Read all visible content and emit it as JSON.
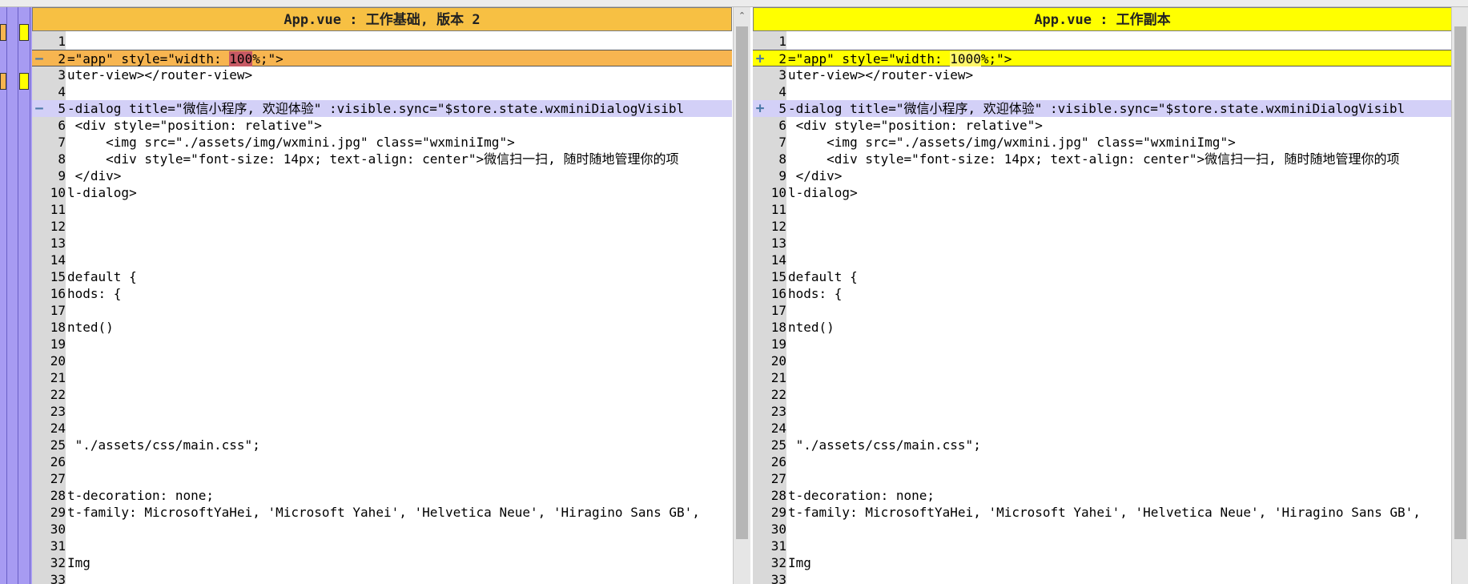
{
  "colors": {
    "left_header": "#f7c043",
    "right_header": "#ffff00",
    "changed_line": "#d3d0f7",
    "left_changed_strong": "#f7b550",
    "right_changed_strong": "#ffff00",
    "location_bar": "#a79bf2",
    "gutter": "#d9d9d9",
    "marker": "#4c7aa8"
  },
  "left_pane": {
    "title": "App.vue : 工作基础, 版本 2",
    "marker_glyph": "−",
    "lines": [
      {
        "num": "1",
        "pre": "",
        "hl": "",
        "post": "",
        "status": ""
      },
      {
        "num": "2",
        "pre": "=\"app\" style=\"width: ",
        "hl": "100",
        "post": "%;\">",
        "status": "strong"
      },
      {
        "num": "3",
        "pre": "uter-view></router-view>",
        "hl": "",
        "post": "",
        "status": ""
      },
      {
        "num": "4",
        "pre": "",
        "hl": "",
        "post": "",
        "status": ""
      },
      {
        "num": "5",
        "pre": "-dialog title=\"微信小程序, 欢迎体验\" :visible.sync=\"$store.state.wxminiDialogVisibl",
        "hl": "",
        "post": "",
        "status": "changed"
      },
      {
        "num": "6",
        "pre": " <div style=\"position: relative\">",
        "hl": "",
        "post": "",
        "status": ""
      },
      {
        "num": "7",
        "pre": "     <img src=\"./assets/img/wxmini.jpg\" class=\"wxminiImg\">",
        "hl": "",
        "post": "",
        "status": ""
      },
      {
        "num": "8",
        "pre": "     <div style=\"font-size: 14px; text-align: center\">微信扫一扫, 随时随地管理你的项",
        "hl": "",
        "post": "",
        "status": ""
      },
      {
        "num": "9",
        "pre": " </div>",
        "hl": "",
        "post": "",
        "status": ""
      },
      {
        "num": "10",
        "pre": "l-dialog>",
        "hl": "",
        "post": "",
        "status": ""
      },
      {
        "num": "11",
        "pre": "",
        "hl": "",
        "post": "",
        "status": ""
      },
      {
        "num": "12",
        "pre": "",
        "hl": "",
        "post": "",
        "status": ""
      },
      {
        "num": "13",
        "pre": "",
        "hl": "",
        "post": "",
        "status": ""
      },
      {
        "num": "14",
        "pre": "",
        "hl": "",
        "post": "",
        "status": ""
      },
      {
        "num": "15",
        "pre": "default {",
        "hl": "",
        "post": "",
        "status": ""
      },
      {
        "num": "16",
        "pre": "hods: {",
        "hl": "",
        "post": "",
        "status": ""
      },
      {
        "num": "17",
        "pre": "",
        "hl": "",
        "post": "",
        "status": ""
      },
      {
        "num": "18",
        "pre": "nted()",
        "hl": "",
        "post": "",
        "status": ""
      },
      {
        "num": "19",
        "pre": "",
        "hl": "",
        "post": "",
        "status": ""
      },
      {
        "num": "20",
        "pre": "",
        "hl": "",
        "post": "",
        "status": ""
      },
      {
        "num": "21",
        "pre": "",
        "hl": "",
        "post": "",
        "status": ""
      },
      {
        "num": "22",
        "pre": "",
        "hl": "",
        "post": "",
        "status": ""
      },
      {
        "num": "23",
        "pre": "",
        "hl": "",
        "post": "",
        "status": ""
      },
      {
        "num": "24",
        "pre": "",
        "hl": "",
        "post": "",
        "status": ""
      },
      {
        "num": "25",
        "pre": " \"./assets/css/main.css\";",
        "hl": "",
        "post": "",
        "status": ""
      },
      {
        "num": "26",
        "pre": "",
        "hl": "",
        "post": "",
        "status": ""
      },
      {
        "num": "27",
        "pre": "",
        "hl": "",
        "post": "",
        "status": ""
      },
      {
        "num": "28",
        "pre": "t-decoration: none;",
        "hl": "",
        "post": "",
        "status": ""
      },
      {
        "num": "29",
        "pre": "t-family: MicrosoftYaHei, 'Microsoft Yahei', 'Helvetica Neue', 'Hiragino Sans GB',",
        "hl": "",
        "post": "",
        "status": ""
      },
      {
        "num": "30",
        "pre": "",
        "hl": "",
        "post": "",
        "status": ""
      },
      {
        "num": "31",
        "pre": "",
        "hl": "",
        "post": "",
        "status": ""
      },
      {
        "num": "32",
        "pre": "Img",
        "hl": "",
        "post": "",
        "status": ""
      },
      {
        "num": "33",
        "pre": "",
        "hl": "",
        "post": "",
        "status": ""
      }
    ]
  },
  "right_pane": {
    "title": "App.vue : 工作副本",
    "marker_glyph": "+",
    "lines": [
      {
        "num": "1",
        "pre": "",
        "hl": "",
        "post": "",
        "status": ""
      },
      {
        "num": "2",
        "pre": "=\"app\" style=\"width: ",
        "hl": "1000",
        "post": "%;\">",
        "status": "strong"
      },
      {
        "num": "3",
        "pre": "uter-view></router-view>",
        "hl": "",
        "post": "",
        "status": ""
      },
      {
        "num": "4",
        "pre": "",
        "hl": "",
        "post": "",
        "status": ""
      },
      {
        "num": "5",
        "pre": "-dialog title=\"微信小程序, 欢迎体验\" :visible.sync=\"$store.state.wxminiDialogVisibl",
        "hl": "",
        "post": "",
        "status": "changed"
      },
      {
        "num": "6",
        "pre": " <div style=\"position: relative\">",
        "hl": "",
        "post": "",
        "status": ""
      },
      {
        "num": "7",
        "pre": "     <img src=\"./assets/img/wxmini.jpg\" class=\"wxminiImg\">",
        "hl": "",
        "post": "",
        "status": ""
      },
      {
        "num": "8",
        "pre": "     <div style=\"font-size: 14px; text-align: center\">微信扫一扫, 随时随地管理你的项",
        "hl": "",
        "post": "",
        "status": ""
      },
      {
        "num": "9",
        "pre": " </div>",
        "hl": "",
        "post": "",
        "status": ""
      },
      {
        "num": "10",
        "pre": "l-dialog>",
        "hl": "",
        "post": "",
        "status": ""
      },
      {
        "num": "11",
        "pre": "",
        "hl": "",
        "post": "",
        "status": ""
      },
      {
        "num": "12",
        "pre": "",
        "hl": "",
        "post": "",
        "status": ""
      },
      {
        "num": "13",
        "pre": "",
        "hl": "",
        "post": "",
        "status": ""
      },
      {
        "num": "14",
        "pre": "",
        "hl": "",
        "post": "",
        "status": ""
      },
      {
        "num": "15",
        "pre": "default {",
        "hl": "",
        "post": "",
        "status": ""
      },
      {
        "num": "16",
        "pre": "hods: {",
        "hl": "",
        "post": "",
        "status": ""
      },
      {
        "num": "17",
        "pre": "",
        "hl": "",
        "post": "",
        "status": ""
      },
      {
        "num": "18",
        "pre": "nted()",
        "hl": "",
        "post": "",
        "status": ""
      },
      {
        "num": "19",
        "pre": "",
        "hl": "",
        "post": "",
        "status": ""
      },
      {
        "num": "20",
        "pre": "",
        "hl": "",
        "post": "",
        "status": ""
      },
      {
        "num": "21",
        "pre": "",
        "hl": "",
        "post": "",
        "status": ""
      },
      {
        "num": "22",
        "pre": "",
        "hl": "",
        "post": "",
        "status": ""
      },
      {
        "num": "23",
        "pre": "",
        "hl": "",
        "post": "",
        "status": ""
      },
      {
        "num": "24",
        "pre": "",
        "hl": "",
        "post": "",
        "status": ""
      },
      {
        "num": "25",
        "pre": " \"./assets/css/main.css\";",
        "hl": "",
        "post": "",
        "status": ""
      },
      {
        "num": "26",
        "pre": "",
        "hl": "",
        "post": "",
        "status": ""
      },
      {
        "num": "27",
        "pre": "",
        "hl": "",
        "post": "",
        "status": ""
      },
      {
        "num": "28",
        "pre": "t-decoration: none;",
        "hl": "",
        "post": "",
        "status": ""
      },
      {
        "num": "29",
        "pre": "t-family: MicrosoftYaHei, 'Microsoft Yahei', 'Helvetica Neue', 'Hiragino Sans GB',",
        "hl": "",
        "post": "",
        "status": ""
      },
      {
        "num": "30",
        "pre": "",
        "hl": "",
        "post": "",
        "status": ""
      },
      {
        "num": "31",
        "pre": "",
        "hl": "",
        "post": "",
        "status": ""
      },
      {
        "num": "32",
        "pre": "Img",
        "hl": "",
        "post": "",
        "status": ""
      },
      {
        "num": "33",
        "pre": "",
        "hl": "",
        "post": "",
        "status": ""
      }
    ]
  },
  "scrollbar": {
    "up_glyph": "⌃"
  }
}
